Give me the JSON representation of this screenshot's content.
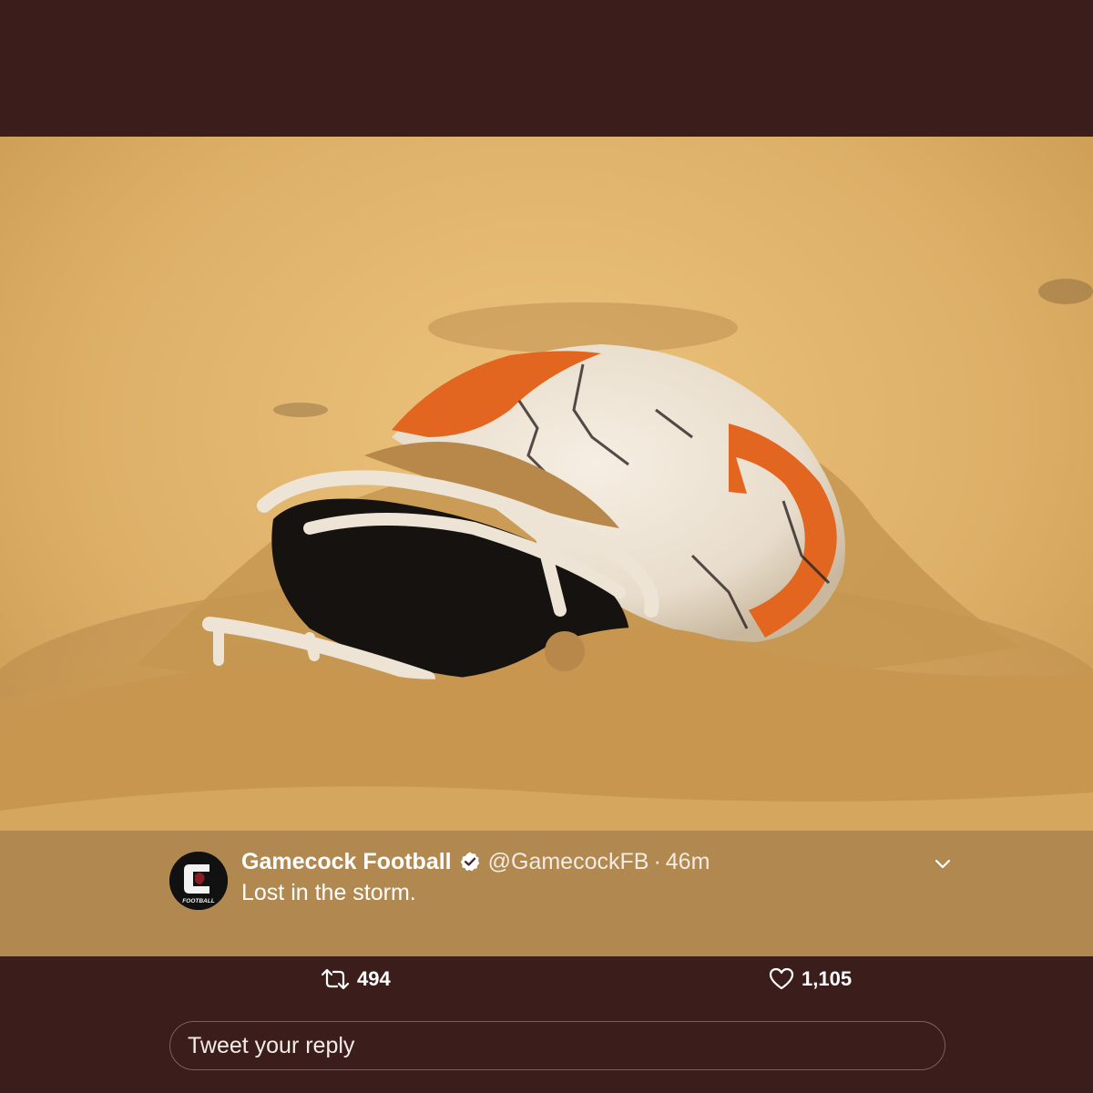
{
  "tweet": {
    "author_name": "Gamecock Football",
    "handle": "@GamecockFB",
    "separator": "·",
    "time": "46m",
    "text": "Lost in the storm.",
    "verified": true,
    "avatar_logo_text": "FOOTBALL"
  },
  "actions": {
    "retweet_count": "494",
    "like_count": "1,105"
  },
  "reply": {
    "placeholder": "Tweet your reply"
  },
  "icons": {
    "verified": "verified-badge-icon",
    "caret": "chevron-down-icon",
    "retweet": "retweet-icon",
    "like": "heart-icon"
  },
  "colors": {
    "background": "#3b1e1c",
    "text": "#ffffff",
    "helmet_orange": "#e2661f"
  }
}
